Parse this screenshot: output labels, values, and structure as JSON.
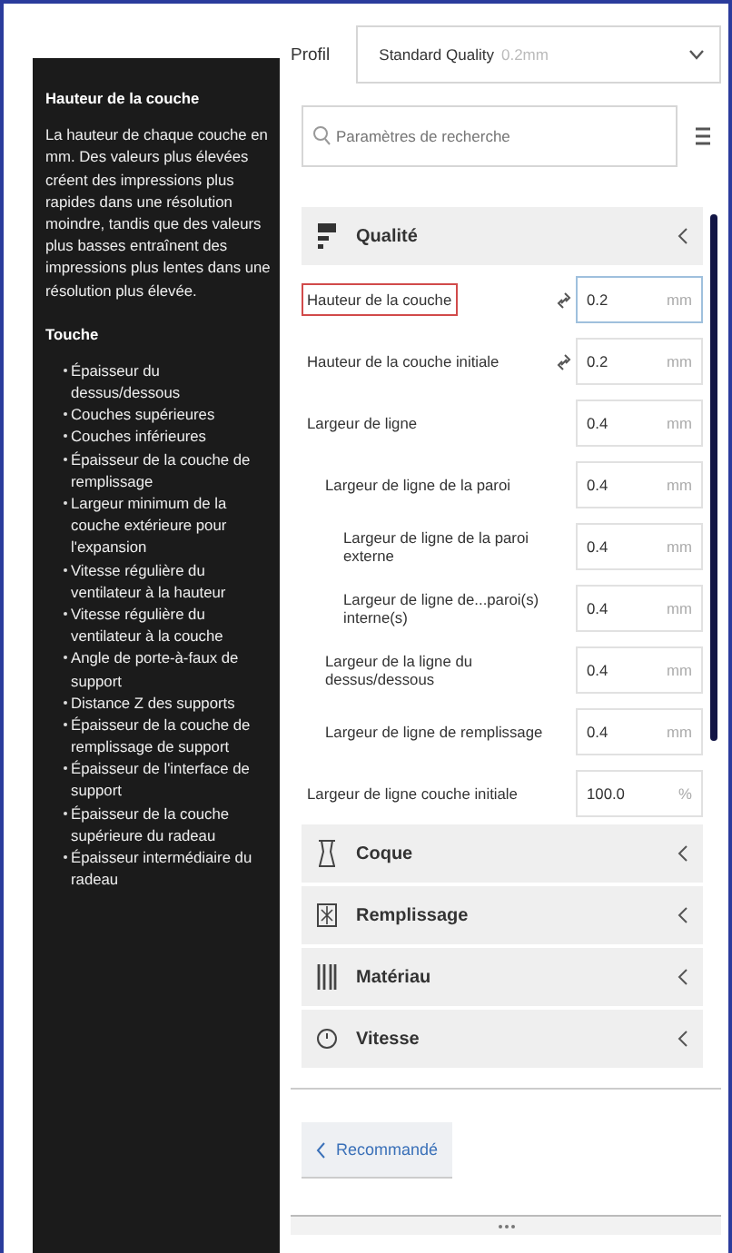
{
  "tooltip": {
    "title": "Hauteur de la couche",
    "description": "La hauteur de chaque couche en mm. Des valeurs plus élevées créent des impressions plus rapides dans une résolution moindre, tandis que des valeurs plus basses entraînent des impressions plus lentes dans une résolution plus élevée.",
    "affects_title": "Touche",
    "affects": [
      "Épaisseur du dessus/dessous",
      "Couches supérieures",
      "Couches inférieures",
      "Épaisseur de la couche de remplissage",
      "Largeur minimum de la couche extérieure pour l'expansion",
      "Vitesse régulière du ventilateur à la hauteur",
      "Vitesse régulière du ventilateur à la couche",
      "Angle de porte-à-faux de support",
      "Distance Z des supports",
      "Épaisseur de la couche de remplissage de support",
      "Épaisseur de l'interface de support",
      "Épaisseur de la couche supérieure du radeau",
      "Épaisseur intermédiaire du radeau"
    ]
  },
  "profile": {
    "label": "Profil",
    "value": "Standard Quality",
    "suffix": "0.2mm"
  },
  "search": {
    "placeholder": "Paramètres de recherche"
  },
  "sections": [
    {
      "kind": "quality",
      "title": "Qualité",
      "settings": [
        {
          "label": "Hauteur de la couche",
          "value": "0.2",
          "unit": "mm",
          "linked": true,
          "highlighted": true
        },
        {
          "label": "Hauteur de la couche initiale",
          "value": "0.2",
          "unit": "mm",
          "linked": true,
          "highlighted": false
        },
        {
          "label": "Largeur de ligne",
          "value": "0.4",
          "unit": "mm",
          "linked": false,
          "highlighted": false,
          "children": [
            {
              "label": "Largeur de ligne de la paroi",
              "value": "0.4",
              "unit": "mm",
              "linked": false,
              "highlighted": false,
              "children": [
                {
                  "label": "Largeur de ligne de la paroi externe",
                  "value": "0.4",
                  "unit": "mm",
                  "linked": false,
                  "highlighted": false
                },
                {
                  "label": "Largeur de ligne de...paroi(s) interne(s)",
                  "value": "0.4",
                  "unit": "mm",
                  "linked": false,
                  "highlighted": false
                }
              ]
            },
            {
              "label": "Largeur de la ligne du dessus/dessous",
              "value": "0.4",
              "unit": "mm",
              "linked": false,
              "highlighted": false
            },
            {
              "label": "Largeur de ligne de remplissage",
              "value": "0.4",
              "unit": "mm",
              "linked": false,
              "highlighted": false
            }
          ]
        },
        {
          "label": "Largeur de ligne couche initiale",
          "value": "100.0",
          "unit": "%",
          "linked": false,
          "highlighted": false
        }
      ]
    },
    {
      "kind": "shell",
      "title": "Coque"
    },
    {
      "kind": "infill",
      "title": "Remplissage"
    },
    {
      "kind": "material",
      "title": "Matériau"
    },
    {
      "kind": "speed",
      "title": "Vitesse"
    }
  ],
  "footer": {
    "button": "Recommandé"
  }
}
